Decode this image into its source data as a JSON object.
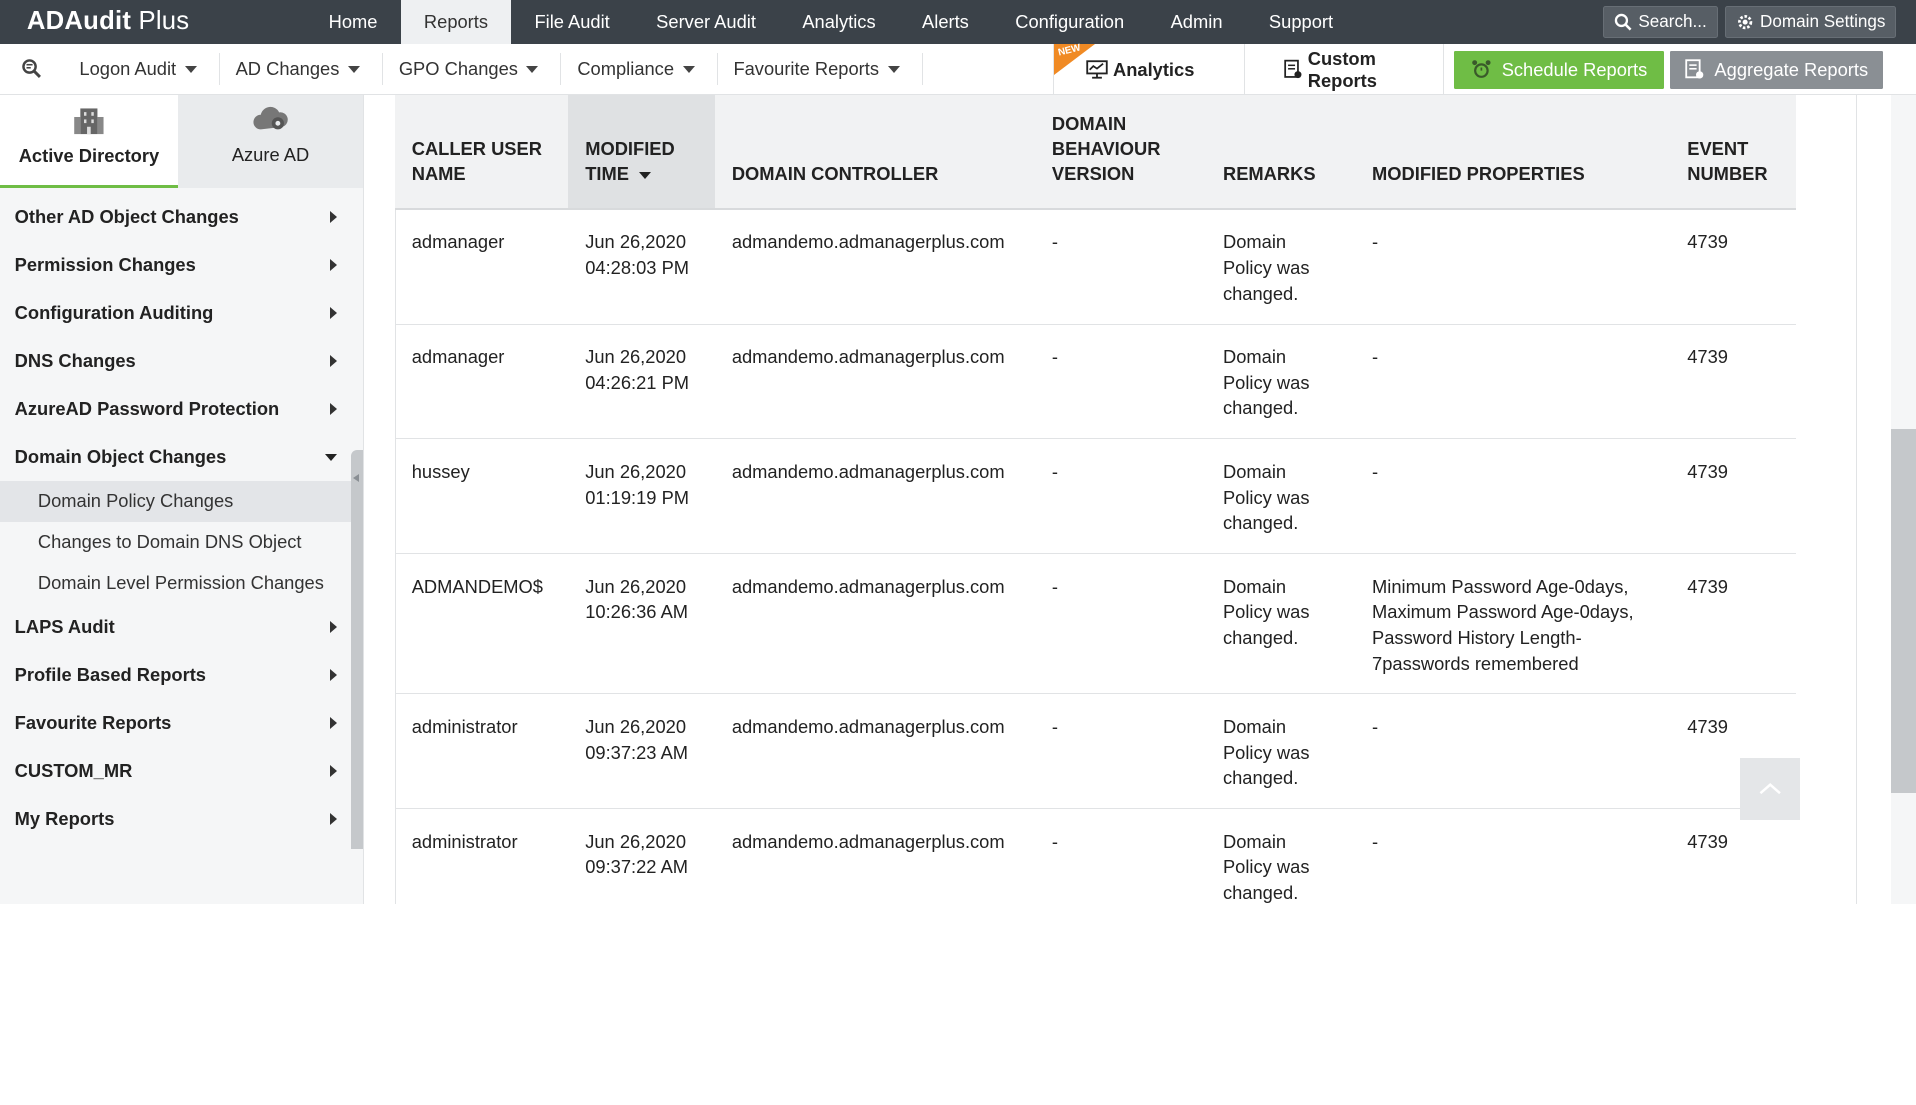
{
  "app": {
    "title_bold": "ADAudit",
    "title_rest": " Plus"
  },
  "topnav": [
    {
      "label": "Home",
      "active": false
    },
    {
      "label": "Reports",
      "active": true
    },
    {
      "label": "File Audit",
      "active": false
    },
    {
      "label": "Server Audit",
      "active": false
    },
    {
      "label": "Analytics",
      "active": false
    },
    {
      "label": "Alerts",
      "active": false
    },
    {
      "label": "Configuration",
      "active": false
    },
    {
      "label": "Admin",
      "active": false
    },
    {
      "label": "Support",
      "active": false
    }
  ],
  "top_right": {
    "search_label": "Search...",
    "domain_settings_label": "Domain Settings"
  },
  "subbar": {
    "menus": [
      "Logon Audit",
      "AD Changes",
      "GPO Changes",
      "Compliance",
      "Favourite Reports"
    ],
    "new_badge": "NEW",
    "analytics_label": "Analytics",
    "custom_reports_label": "Custom Reports",
    "schedule_reports_label": "Schedule Reports",
    "aggregate_reports_label": "Aggregate Reports"
  },
  "sidebar": {
    "tabs": [
      {
        "label": "Active Directory",
        "icon": "building-icon",
        "active": true
      },
      {
        "label": "Azure AD",
        "icon": "cloud-icon",
        "active": false
      }
    ],
    "groups_top": [
      "Other AD Object Changes",
      "Permission Changes",
      "Configuration Auditing",
      "DNS Changes",
      "AzureAD Password Protection"
    ],
    "expanded_group": "Domain Object Changes",
    "sub_items": [
      {
        "label": "Domain Policy Changes",
        "active": true
      },
      {
        "label": "Changes to Domain DNS Object",
        "active": false
      },
      {
        "label": "Domain Level Permission Changes",
        "active": false
      }
    ],
    "groups_bottom": [
      "LAPS Audit",
      "Profile Based Reports",
      "Favourite Reports",
      "CUSTOM_MR",
      "My Reports"
    ]
  },
  "table": {
    "columns": [
      {
        "label": "CALLER USER NAME",
        "lines": [
          "CALLER USER",
          "NAME"
        ]
      },
      {
        "label": "MODIFIED TIME",
        "lines": [
          "MODIFIED",
          "TIME"
        ],
        "sorted": true
      },
      {
        "label": "DOMAIN CONTROLLER",
        "lines": [
          "DOMAIN CONTROLLER"
        ]
      },
      {
        "label": "DOMAIN BEHAVIOUR VERSION",
        "lines": [
          "DOMAIN",
          "BEHAVIOUR",
          "VERSION"
        ]
      },
      {
        "label": "REMARKS",
        "lines": [
          "REMARKS"
        ]
      },
      {
        "label": "MODIFIED PROPERTIES",
        "lines": [
          "MODIFIED PROPERTIES"
        ]
      },
      {
        "label": "EVENT NUMBER",
        "lines": [
          "EVENT",
          "NUMBER"
        ]
      }
    ],
    "rows": [
      {
        "user": "admanager",
        "time_date": "Jun 26,2020",
        "time_clock": "04:28:03 PM",
        "dc": "admandemo.admanagerplus.com",
        "version": "-",
        "remarks": [
          "Domain",
          "Policy was",
          "changed."
        ],
        "props": [
          "-"
        ],
        "event": "4739"
      },
      {
        "user": "admanager",
        "time_date": "Jun 26,2020",
        "time_clock": "04:26:21 PM",
        "dc": "admandemo.admanagerplus.com",
        "version": "-",
        "remarks": [
          "Domain",
          "Policy was",
          "changed."
        ],
        "props": [
          "-"
        ],
        "event": "4739"
      },
      {
        "user": "hussey",
        "time_date": "Jun 26,2020",
        "time_clock": "01:19:19 PM",
        "dc": "admandemo.admanagerplus.com",
        "version": "-",
        "remarks": [
          "Domain",
          "Policy was",
          "changed."
        ],
        "props": [
          "-"
        ],
        "event": "4739"
      },
      {
        "user": "ADMANDEMO$",
        "time_date": "Jun 26,2020",
        "time_clock": "10:26:36 AM",
        "dc": "admandemo.admanagerplus.com",
        "version": "-",
        "remarks": [
          "Domain",
          "Policy was",
          "changed."
        ],
        "props": [
          "Minimum Password Age-0days,",
          "Maximum Password Age-0days,",
          "Password History Length-",
          "7passwords remembered"
        ],
        "event": "4739"
      },
      {
        "user": "administrator",
        "time_date": "Jun 26,2020",
        "time_clock": "09:37:23 AM",
        "dc": "admandemo.admanagerplus.com",
        "version": "-",
        "remarks": [
          "Domain",
          "Policy was",
          "changed."
        ],
        "props": [
          "-"
        ],
        "event": "4739"
      },
      {
        "user": "administrator",
        "time_date": "Jun 26,2020",
        "time_clock": "09:37:22 AM",
        "dc": "admandemo.admanagerplus.com",
        "version": "-",
        "remarks": [
          "Domain",
          "Policy was",
          "changed."
        ],
        "props": [
          "-"
        ],
        "event": "4739"
      }
    ]
  },
  "colors": {
    "topbar": "#3b4249",
    "accent_green": "#6fbd45",
    "new_badge": "#f08a24",
    "gray_button": "#8a8f94"
  }
}
